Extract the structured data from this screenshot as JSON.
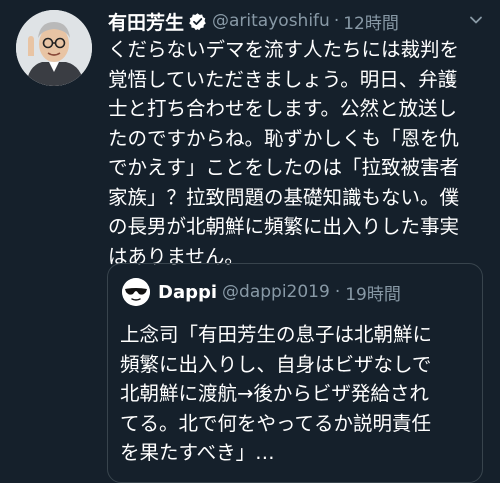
{
  "tweet": {
    "display_name": "有田芳生",
    "handle": "@aritayoshifu",
    "separator": "·",
    "time": "12時間",
    "text_lines": [
      "くだらないデマを流す人たちには裁判を",
      "覚悟していただきましょう。明日、弁護",
      "士と打ち合わせをします。公然と放送し",
      "たのですからね。恥ずかしくも「恩を仇",
      "でかえす」ことをしたのは「拉致被害者",
      "家族」？拉致問題の基礎知識もない。僕",
      "の長男が北朝鮮に頻繁に出入りした事実",
      "はありません。"
    ],
    "verified_icon": "verified-badge-icon",
    "menu_icon": "chevron-down-icon"
  },
  "quoted_tweet": {
    "display_name": "Dappi",
    "handle": "@dappi2019",
    "separator": "·",
    "time": "19時間",
    "text_lines": [
      "上念司「有田芳生の息子は北朝鮮に",
      "頻繁に出入りし、自身はビザなしで",
      "北朝鮮に渡航→後からビザ発給され",
      "てる。北で何をやってるか説明責任",
      "を果たすべき」…"
    ]
  },
  "colors": {
    "background": "#15202b",
    "primary_text": "#ffffff",
    "secondary_text": "#8899a6",
    "border": "#38444d",
    "verified": "#ffffff"
  }
}
